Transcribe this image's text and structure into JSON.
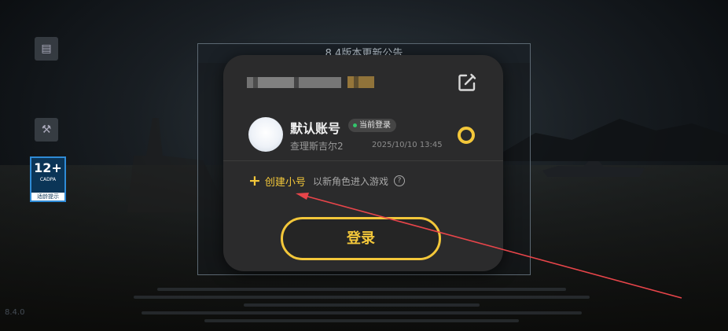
{
  "notice": {
    "title": "8.4版本更新公告"
  },
  "sidebar": {
    "age_rating": {
      "number": "12+",
      "sub": "CADPA",
      "footer": "适龄提示"
    }
  },
  "footer": {
    "version": "8.4.0"
  },
  "account_dialog": {
    "accounts": [
      {
        "name": "默认账号",
        "badge": "当前登录",
        "role": "查理斯吉尔2",
        "last_login": "2025/10/10 13:45",
        "selected": true
      }
    ],
    "create": {
      "label": "创建小号",
      "hint": "以新角色进入游戏",
      "help": "?"
    },
    "login_button": "登录"
  },
  "colors": {
    "accent": "#f3c73a",
    "dialog_bg": "#2b2b2c",
    "status_dot": "#33c56b",
    "annotation_arrow": "#e8454a"
  }
}
